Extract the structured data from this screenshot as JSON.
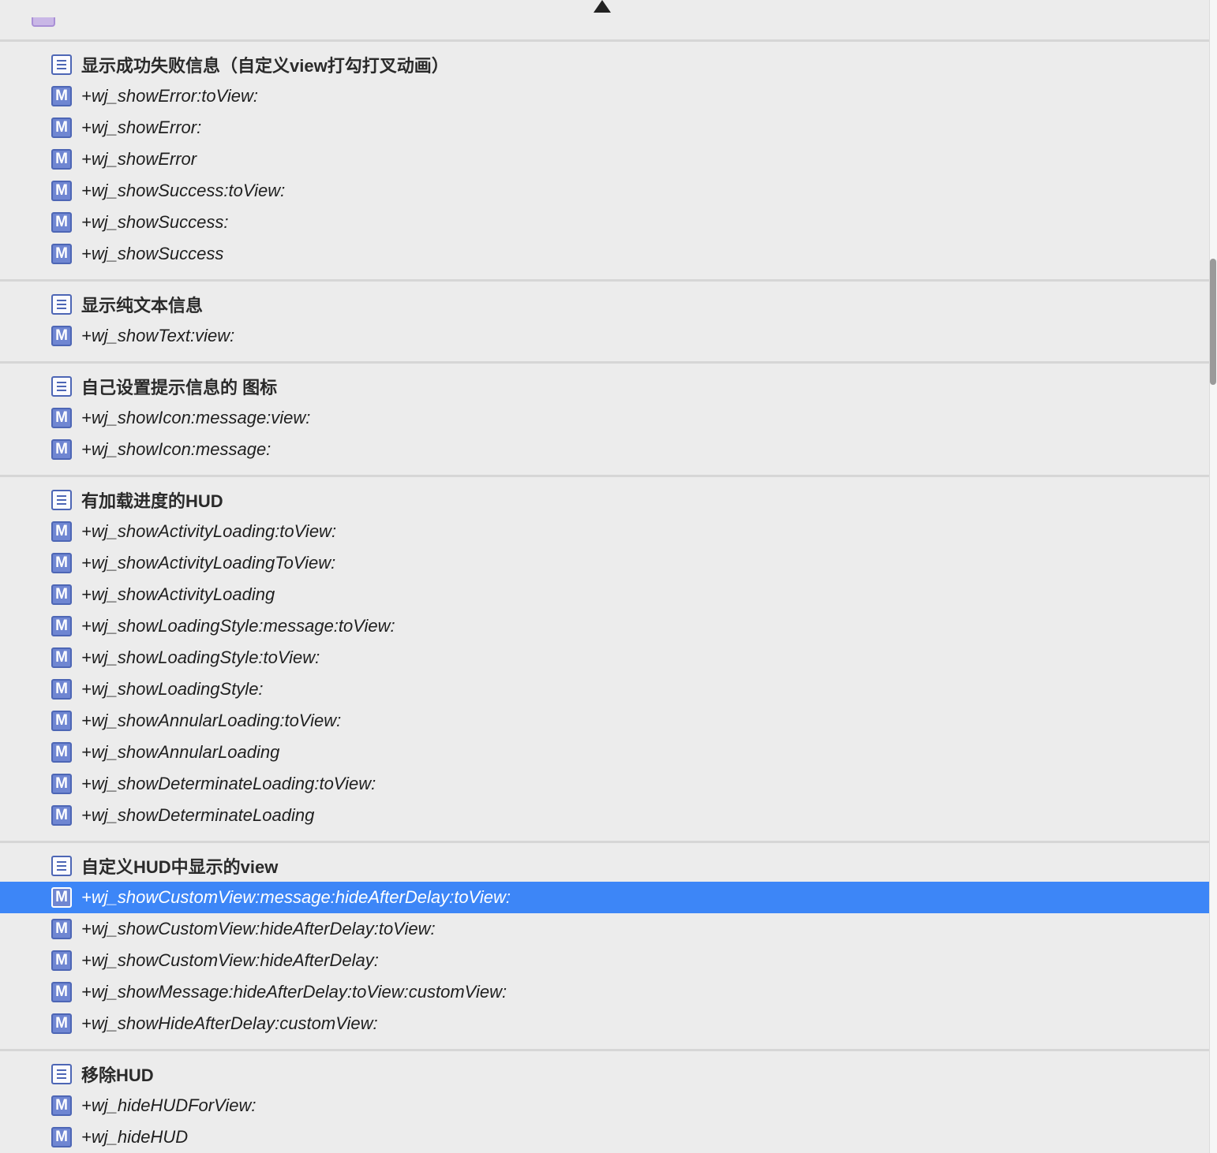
{
  "sections": [
    {
      "header": "显示成功失败信息（自定义view打勾打叉动画）",
      "methods": [
        "+wj_showError:toView:",
        "+wj_showError:",
        "+wj_showError",
        "+wj_showSuccess:toView:",
        "+wj_showSuccess:",
        "+wj_showSuccess"
      ]
    },
    {
      "header": "显示纯文本信息",
      "methods": [
        "+wj_showText:view:"
      ]
    },
    {
      "header": "自己设置提示信息的 图标",
      "methods": [
        "+wj_showIcon:message:view:",
        "+wj_showIcon:message:"
      ]
    },
    {
      "header": "有加载进度的HUD",
      "methods": [
        "+wj_showActivityLoading:toView:",
        "+wj_showActivityLoadingToView:",
        "+wj_showActivityLoading",
        "+wj_showLoadingStyle:message:toView:",
        "+wj_showLoadingStyle:toView:",
        "+wj_showLoadingStyle:",
        "+wj_showAnnularLoading:toView:",
        "+wj_showAnnularLoading",
        "+wj_showDeterminateLoading:toView:",
        "+wj_showDeterminateLoading"
      ]
    },
    {
      "header": "自定义HUD中显示的view",
      "methods": [
        "+wj_showCustomView:message:hideAfterDelay:toView:",
        "+wj_showCustomView:hideAfterDelay:toView:",
        "+wj_showCustomView:hideAfterDelay:",
        "+wj_showMessage:hideAfterDelay:toView:customView:",
        "+wj_showHideAfterDelay:customView:"
      ]
    },
    {
      "header": "移除HUD",
      "methods": [
        "+wj_hideHUDForView:",
        "+wj_hideHUD"
      ]
    }
  ],
  "selected": {
    "section": 4,
    "method": 0
  },
  "method_icon_letter": "M",
  "colors": {
    "selection": "#3d86f7",
    "icon": "#6f86d2",
    "background": "#ececec"
  }
}
